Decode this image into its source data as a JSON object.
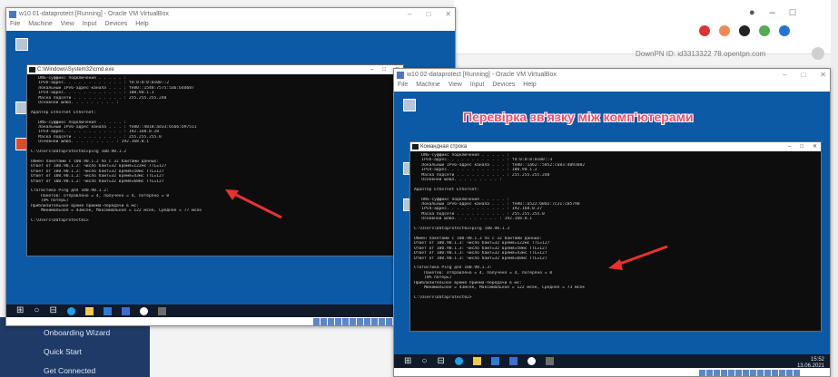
{
  "host": {
    "id_text": "DownPN ID: id3313322 78.opentpn.com",
    "left_menu": [
      "Onboarding Wizard",
      "Quick Start",
      "Get Connected"
    ]
  },
  "vm_left": {
    "title": "w10 01-dataprotect [Running] - Oracle VM VirtualBox",
    "menu": [
      "File",
      "Machine",
      "View",
      "Input",
      "Devices",
      "Help"
    ],
    "console_title": "C:\\Windows\\System32\\cmd.exe",
    "console_lines": [
      "   DNS-суффикс подключения . . . . . :",
      "   IPv6-адрес. . . . . . . . . . . . : fd:0:0:0:0100::2",
      "   Локальный IPv6-адрес канала . . . : fe80::1548:7575:5a6:b4d687",
      "   IPv4-адрес. . . . . . . . . . . . : 100.90.1.3",
      "   Маска подсети . . . . . . . . . . : 255.255.255.248",
      "   Основной шлюз. . . . . . . . . :",
      "",
      "Адаптер Ethernet Ethernet:",
      "",
      "   DNS-суффикс подключения . . . . . :",
      "   Локальный IPv6-адрес канала . . . : fe80::4818:ad33:6566:b97511",
      "   IPv4-адрес. . . . . . . . . . . . : 192.168.0.18",
      "   Маска подсети . . . . . . . . . . : 255.255.255.0",
      "   Основной шлюз. . . . . . . . . : 192.168.0.1",
      "",
      "C:\\Users\\Dataprotect01>ping 100.90.1.2",
      "",
      "Обмен пакетами с 100.90.1.2 по с 32 байтами данных:",
      "Ответ от 100.90.1.2: число байт=32 время=122мс TTL=127",
      "Ответ от 100.90.1.2: число байт=32 время=58мс TTL=127",
      "Ответ от 100.90.1.2: число байт=32 время=43мс TTL=127",
      "Ответ от 100.90.1.2: число байт=32 время=68мс TTL=127",
      "",
      "Статистика Ping для 100.90.1.2:",
      "    Пакетов: отправлено = 4, получено = 4, потеряно = 0",
      "    (0% потерь)",
      "Приблизительное время приема-передачи в мс:",
      "    Минимальное = 43мсек, Максимальное = 122 мсек, Среднее = 77 мсек",
      "",
      "C:\\Users\\Dataprotect01>"
    ]
  },
  "vm_right": {
    "title": "w10 02-dataprotect [Running] - Oracle VM VirtualBox",
    "menu": [
      "File",
      "Machine",
      "View",
      "Input",
      "Devices",
      "Help"
    ],
    "banner": "Перевірка зв'язку між комп'ютерами",
    "console_title": "Командная строка",
    "console_lines": [
      "   DNS-суффикс подключения . . . . . :",
      "   IPv6-адрес. . . . . . . . . . . . : fd:0:0:0:0100::3",
      "   Локальный IPv6-адрес канала . . . : fe80::1a62::5852:ca83:4093082",
      "   IPv4-адрес. . . . . . . . . . . . : 100.90.1.2",
      "   Маска подсети . . . . . . . . . . : 255.255.255.248",
      "   Основной шлюз. . . . . . . . . :",
      "",
      "Адаптер Ethernet Ethernet:",
      "",
      "   DNS-суффикс подключения . . . . . :",
      "   Локальный IPv6-адрес канала . . . : fe80::a522:6802:7c31:c85790",
      "   IPv4-адрес. . . . . . . . . . . . : 192.168.0.27",
      "   Маска подсети . . . . . . . . . . : 255.255.255.0",
      "   Основной шлюз. . . . . . . . . : 192.168.0.1",
      "",
      "C:\\Users\\Dataprotect02>ping 100.90.1.3",
      "",
      "Обмен пакетами с 100.90.1.3 по с 32 байтами данных:",
      "Ответ от 100.90.1.3: число байт=32 время=122мс TTL=127",
      "Ответ от 100.90.1.3: число байт=32 время=58мс TTL=127",
      "Ответ от 100.90.1.3: число байт=32 время=43мс TTL=127",
      "Ответ от 100.90.1.3: число байт=32 время=68мс TTL=127",
      "",
      "Статистика Ping для 100.90.1.3:",
      "    Пакетов: отправлено = 4, получено = 4, потеряно = 0",
      "    (0% потерь)",
      "Приблизительное время приема-передачи в мс:",
      "    Минимальное = 43мсек, Максимальное = 122 мсек, Среднее = 73 мсек",
      "",
      "C:\\Users\\Dataprotect02>"
    ],
    "clock_time": "15:52",
    "clock_date": "13.06.2021"
  },
  "colors": {
    "desktop": "#0c5aa6",
    "arrow": "#e8322f",
    "banner": "#f04a6a"
  }
}
